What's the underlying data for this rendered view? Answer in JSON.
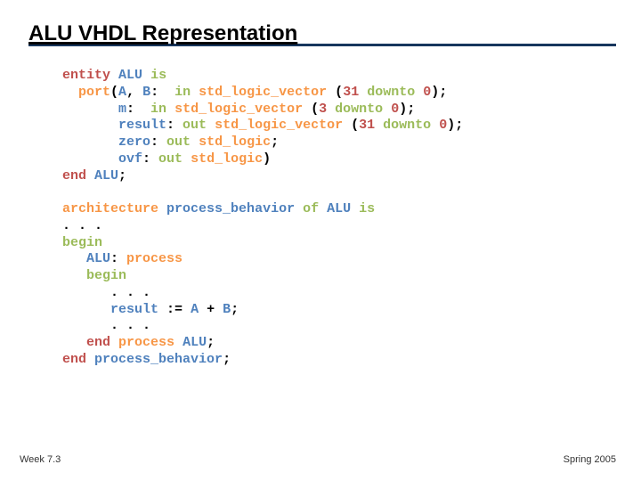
{
  "title": "ALU VHDL Representation",
  "code": {
    "entity": {
      "l1_keyword_entity": "entity",
      "l1_name": "ALU",
      "l1_keyword_is": "is",
      "l2_keyword_port": "port",
      "l2_sig_a": "A",
      "l2_sig_b": "B",
      "l2_dir": "in",
      "l2_type": "std_logic_vector",
      "l2_msb": "31",
      "l2_downto": "downto",
      "l2_lsb": "0",
      "l3_sig_m": "m",
      "l3_dir": "in",
      "l3_type": "std_logic_vector",
      "l3_msb": "3",
      "l3_downto": "downto",
      "l3_lsb": "0",
      "l4_sig_result": "result",
      "l4_dir": "out",
      "l4_type": "std_logic_vector",
      "l4_msb": "31",
      "l4_downto": "downto",
      "l4_lsb": "0",
      "l5_sig_zero": "zero",
      "l5_dir": "out",
      "l5_type": "std_logic",
      "l6_sig_ovf": "ovf",
      "l6_dir": "out",
      "l6_type": "std_logic",
      "l7_end": "end",
      "l7_name": "ALU"
    },
    "arch": {
      "a1_keyword_arch": "architecture",
      "a1_archname": "process_behavior",
      "a1_of": "of",
      "a1_entity": "ALU",
      "a1_is": "is",
      "a2_dots": ". . .",
      "a3_begin": "begin",
      "a4_label": "ALU",
      "a4_process": "process",
      "a5_begin": "begin",
      "a6_dots": ". . .",
      "a7_result": "result",
      "a7_assign": ":=",
      "a7_a": "A",
      "a7_plus": "+",
      "a7_b": "B",
      "a8_dots": ". . .",
      "a9_end": "end",
      "a9_process": "process",
      "a9_label": "ALU",
      "a10_end": "end",
      "a10_archname": "process_behavior"
    }
  },
  "footer_left": "Week 7.3",
  "footer_right": "Spring 2005"
}
